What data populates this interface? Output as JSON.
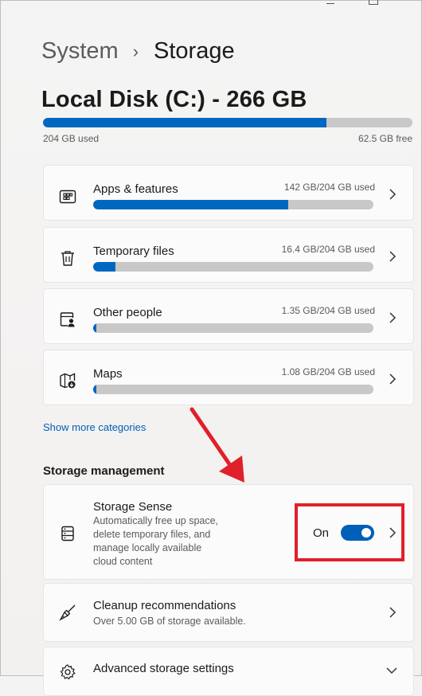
{
  "breadcrumb": {
    "parent": "System",
    "separator": "›",
    "current": "Storage"
  },
  "disk": {
    "title": "Local Disk (C:) - 266 GB",
    "used_label": "204 GB used",
    "free_label": "62.5 GB free",
    "used_fraction": 0.767
  },
  "categories": [
    {
      "label": "Apps & features",
      "usage": "142 GB/204 GB used",
      "fraction": 0.696,
      "icon": "apps-icon"
    },
    {
      "label": "Temporary files",
      "usage": "16.4 GB/204 GB used",
      "fraction": 0.08,
      "icon": "trash-icon"
    },
    {
      "label": "Other people",
      "usage": "1.35 GB/204 GB used",
      "fraction": 0.007,
      "icon": "other-people-icon"
    },
    {
      "label": "Maps",
      "usage": "1.08 GB/204 GB used",
      "fraction": 0.005,
      "icon": "map-icon"
    }
  ],
  "show_more": "Show more categories",
  "storage_management": {
    "heading": "Storage management",
    "storage_sense": {
      "title": "Storage Sense",
      "desc_lines": [
        "Automatically free up space,",
        "delete temporary files, and",
        "manage locally available",
        "cloud content"
      ],
      "toggle_label": "On",
      "toggle_on": true
    },
    "cleanup": {
      "title": "Cleanup recommendations",
      "desc": "Over 5.00 GB of storage available."
    },
    "advanced": {
      "title": "Advanced storage settings"
    }
  },
  "colors": {
    "accent": "#0067c0",
    "annotation": "#e0202a",
    "track": "#c8c8c8"
  }
}
